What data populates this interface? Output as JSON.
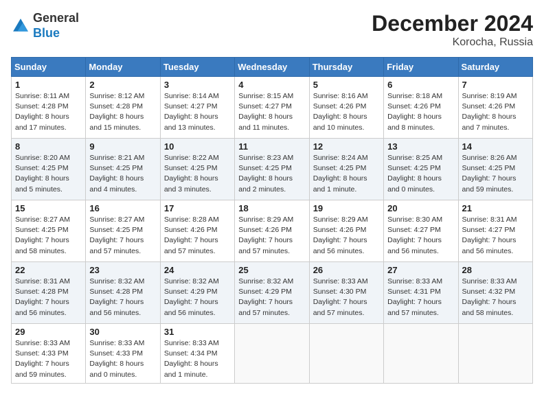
{
  "header": {
    "logo_line1": "General",
    "logo_line2": "Blue",
    "month_title": "December 2024",
    "location": "Korocha, Russia"
  },
  "weekdays": [
    "Sunday",
    "Monday",
    "Tuesday",
    "Wednesday",
    "Thursday",
    "Friday",
    "Saturday"
  ],
  "weeks": [
    [
      {
        "day": 1,
        "sunrise": "8:11 AM",
        "sunset": "4:28 PM",
        "daylight": "8 hours and 17 minutes."
      },
      {
        "day": 2,
        "sunrise": "8:12 AM",
        "sunset": "4:28 PM",
        "daylight": "8 hours and 15 minutes."
      },
      {
        "day": 3,
        "sunrise": "8:14 AM",
        "sunset": "4:27 PM",
        "daylight": "8 hours and 13 minutes."
      },
      {
        "day": 4,
        "sunrise": "8:15 AM",
        "sunset": "4:27 PM",
        "daylight": "8 hours and 11 minutes."
      },
      {
        "day": 5,
        "sunrise": "8:16 AM",
        "sunset": "4:26 PM",
        "daylight": "8 hours and 10 minutes."
      },
      {
        "day": 6,
        "sunrise": "8:18 AM",
        "sunset": "4:26 PM",
        "daylight": "8 hours and 8 minutes."
      },
      {
        "day": 7,
        "sunrise": "8:19 AM",
        "sunset": "4:26 PM",
        "daylight": "8 hours and 7 minutes."
      }
    ],
    [
      {
        "day": 8,
        "sunrise": "8:20 AM",
        "sunset": "4:25 PM",
        "daylight": "8 hours and 5 minutes."
      },
      {
        "day": 9,
        "sunrise": "8:21 AM",
        "sunset": "4:25 PM",
        "daylight": "8 hours and 4 minutes."
      },
      {
        "day": 10,
        "sunrise": "8:22 AM",
        "sunset": "4:25 PM",
        "daylight": "8 hours and 3 minutes."
      },
      {
        "day": 11,
        "sunrise": "8:23 AM",
        "sunset": "4:25 PM",
        "daylight": "8 hours and 2 minutes."
      },
      {
        "day": 12,
        "sunrise": "8:24 AM",
        "sunset": "4:25 PM",
        "daylight": "8 hours and 1 minute."
      },
      {
        "day": 13,
        "sunrise": "8:25 AM",
        "sunset": "4:25 PM",
        "daylight": "8 hours and 0 minutes."
      },
      {
        "day": 14,
        "sunrise": "8:26 AM",
        "sunset": "4:25 PM",
        "daylight": "7 hours and 59 minutes."
      }
    ],
    [
      {
        "day": 15,
        "sunrise": "8:27 AM",
        "sunset": "4:25 PM",
        "daylight": "7 hours and 58 minutes."
      },
      {
        "day": 16,
        "sunrise": "8:27 AM",
        "sunset": "4:25 PM",
        "daylight": "7 hours and 57 minutes."
      },
      {
        "day": 17,
        "sunrise": "8:28 AM",
        "sunset": "4:26 PM",
        "daylight": "7 hours and 57 minutes."
      },
      {
        "day": 18,
        "sunrise": "8:29 AM",
        "sunset": "4:26 PM",
        "daylight": "7 hours and 57 minutes."
      },
      {
        "day": 19,
        "sunrise": "8:29 AM",
        "sunset": "4:26 PM",
        "daylight": "7 hours and 56 minutes."
      },
      {
        "day": 20,
        "sunrise": "8:30 AM",
        "sunset": "4:27 PM",
        "daylight": "7 hours and 56 minutes."
      },
      {
        "day": 21,
        "sunrise": "8:31 AM",
        "sunset": "4:27 PM",
        "daylight": "7 hours and 56 minutes."
      }
    ],
    [
      {
        "day": 22,
        "sunrise": "8:31 AM",
        "sunset": "4:28 PM",
        "daylight": "7 hours and 56 minutes."
      },
      {
        "day": 23,
        "sunrise": "8:32 AM",
        "sunset": "4:28 PM",
        "daylight": "7 hours and 56 minutes."
      },
      {
        "day": 24,
        "sunrise": "8:32 AM",
        "sunset": "4:29 PM",
        "daylight": "7 hours and 56 minutes."
      },
      {
        "day": 25,
        "sunrise": "8:32 AM",
        "sunset": "4:29 PM",
        "daylight": "7 hours and 57 minutes."
      },
      {
        "day": 26,
        "sunrise": "8:33 AM",
        "sunset": "4:30 PM",
        "daylight": "7 hours and 57 minutes."
      },
      {
        "day": 27,
        "sunrise": "8:33 AM",
        "sunset": "4:31 PM",
        "daylight": "7 hours and 57 minutes."
      },
      {
        "day": 28,
        "sunrise": "8:33 AM",
        "sunset": "4:32 PM",
        "daylight": "7 hours and 58 minutes."
      }
    ],
    [
      {
        "day": 29,
        "sunrise": "8:33 AM",
        "sunset": "4:33 PM",
        "daylight": "7 hours and 59 minutes."
      },
      {
        "day": 30,
        "sunrise": "8:33 AM",
        "sunset": "4:33 PM",
        "daylight": "8 hours and 0 minutes."
      },
      {
        "day": 31,
        "sunrise": "8:33 AM",
        "sunset": "4:34 PM",
        "daylight": "8 hours and 1 minute."
      },
      null,
      null,
      null,
      null
    ]
  ]
}
